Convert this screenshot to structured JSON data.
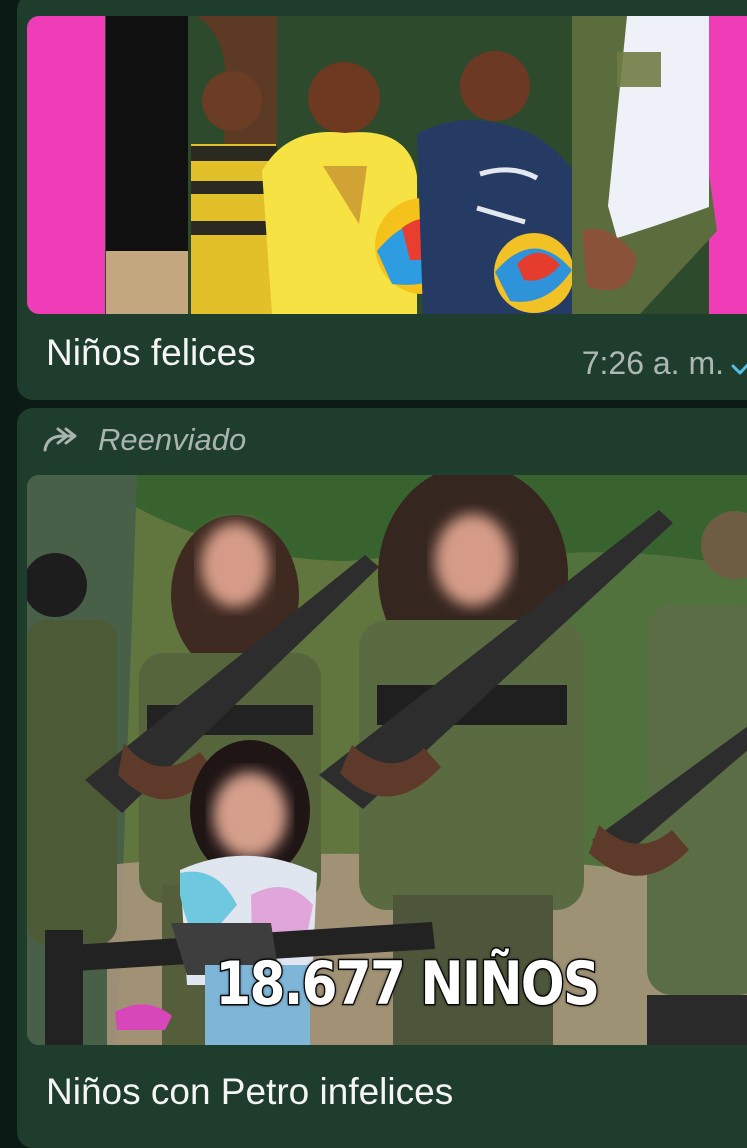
{
  "chat": {
    "messages": [
      {
        "caption": "Niños felices",
        "time": "7:26 a. m.",
        "status_icon": "single-check-icon"
      },
      {
        "forwarded_label": "Reenviado",
        "forwarded_icon": "forward-arrow-icon",
        "image_overlay_text": "18.677 NIÑOS",
        "caption": "Niños con Petro infelices"
      }
    ]
  },
  "colors": {
    "bubble": "#1f3d2c",
    "caption_text": "#f4f5f4",
    "time_text": "#aeb8b2",
    "check": "#53bdeb",
    "pink_frame": "#ef3db8"
  }
}
